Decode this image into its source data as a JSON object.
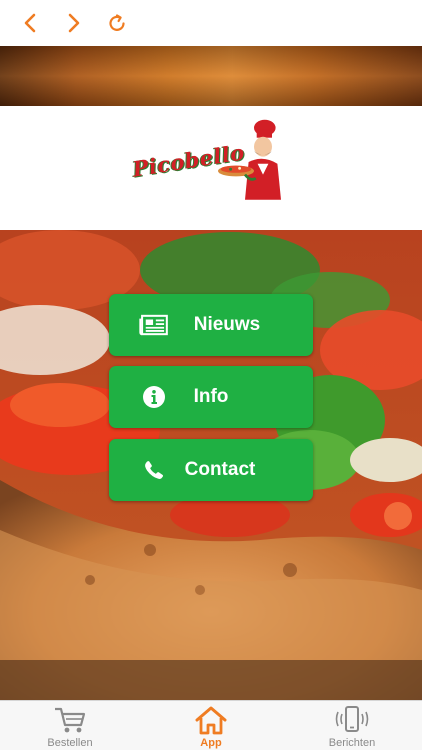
{
  "nav": {
    "back_icon": "chevron-left-icon",
    "forward_icon": "chevron-right-icon",
    "reload_icon": "reload-icon",
    "accent": "#ef7c22"
  },
  "logo": {
    "text": "Picobello"
  },
  "menu": {
    "color": "#1fb043",
    "items": [
      {
        "label": "Nieuws",
        "icon": "newspaper-icon"
      },
      {
        "label": "Info",
        "icon": "info-icon"
      },
      {
        "label": "Contact",
        "icon": "phone-icon"
      }
    ]
  },
  "tabs": [
    {
      "label": "Bestellen",
      "icon": "cart-icon",
      "active": false
    },
    {
      "label": "App",
      "icon": "home-icon",
      "active": true
    },
    {
      "label": "Berichten",
      "icon": "vibrating-phone-icon",
      "active": false
    }
  ]
}
